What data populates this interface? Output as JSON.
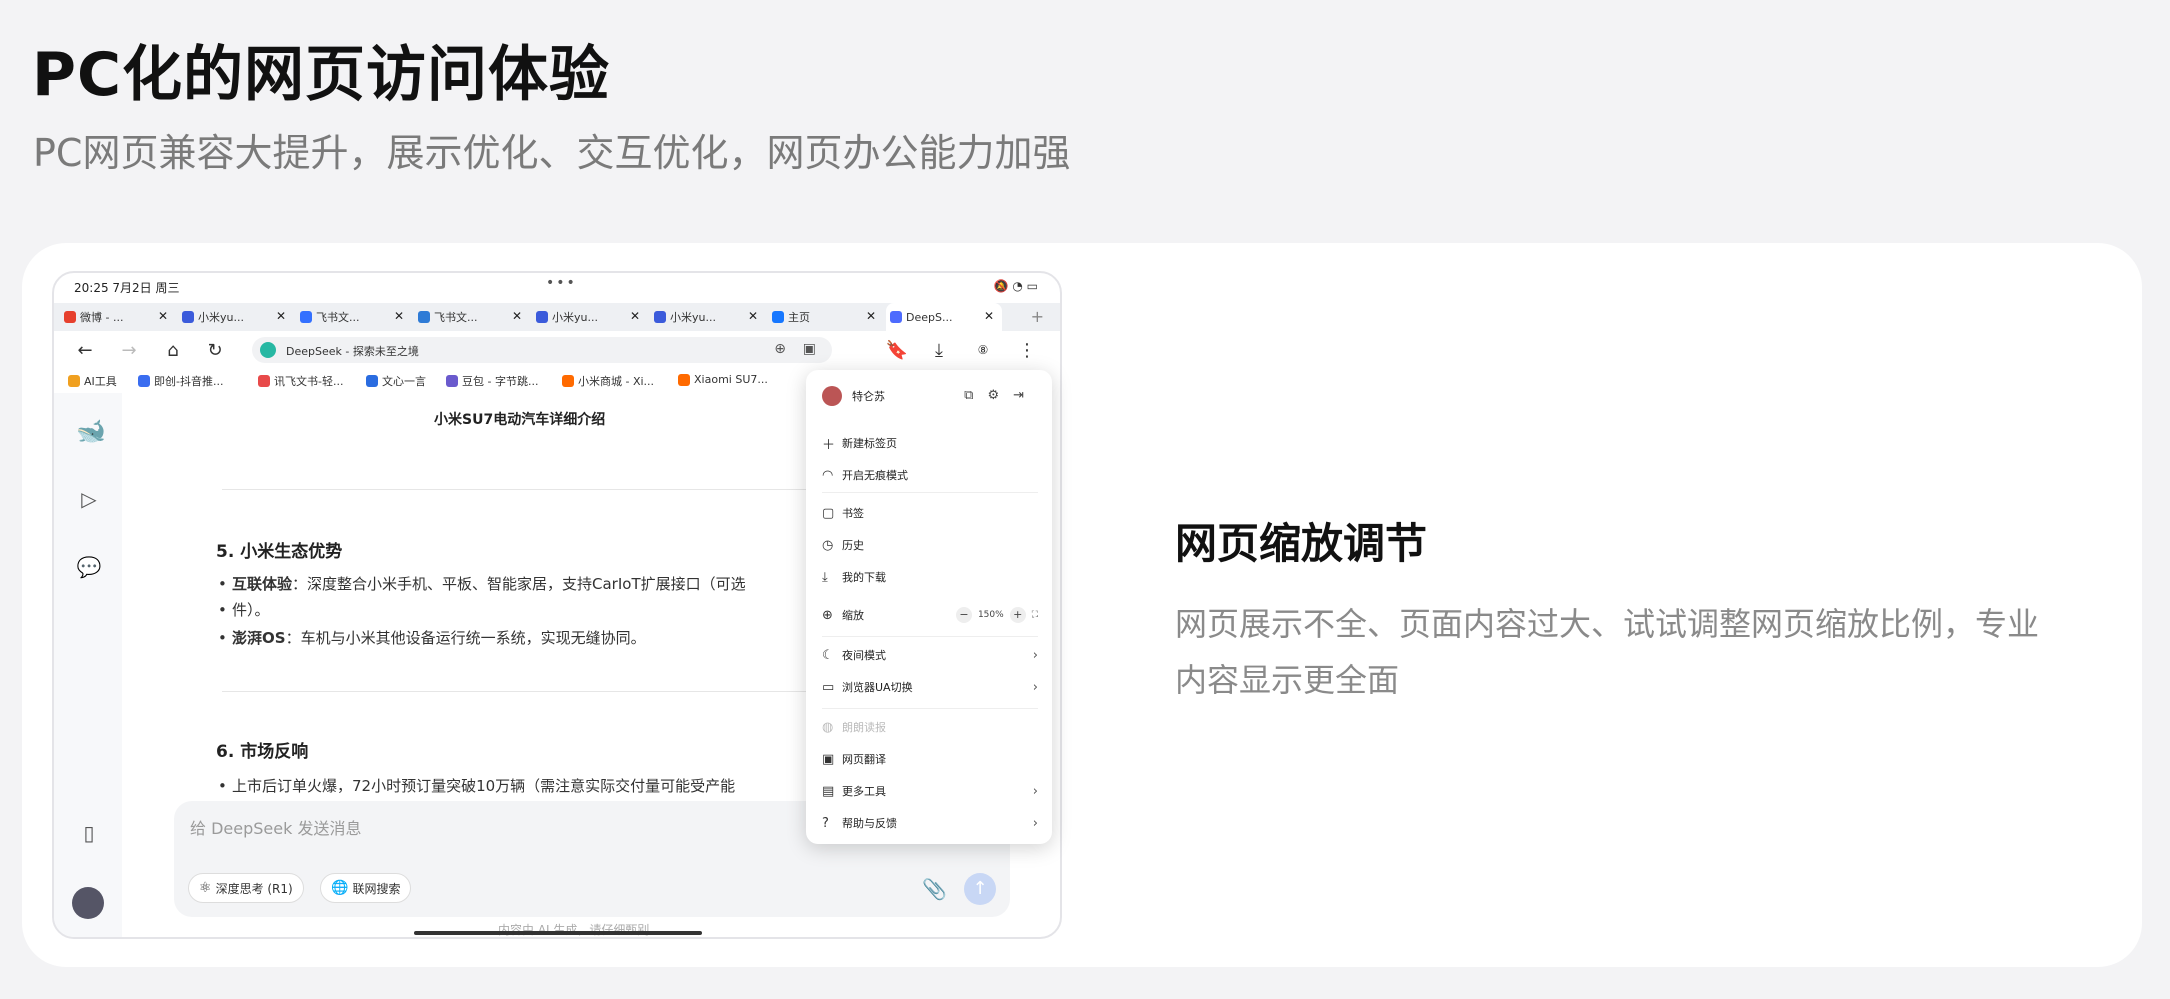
{
  "header": {
    "title": "PC化的网页访问体验",
    "subtitle": "PC网页兼容大提升，展示优化、交互优化，网页办公能力加强"
  },
  "feature": {
    "title": "网页缩放调节",
    "description": "网页展示不全、页面内容过大、试试调整网页缩放比例，专业内容显示更全面"
  },
  "status_bar": {
    "time": "20:25  7月2日 周三",
    "dots": "•••"
  },
  "tabs": [
    {
      "label": "微博 - ...",
      "color": "#e6402d"
    },
    {
      "label": "小米yu...",
      "color": "#3b5bdb"
    },
    {
      "label": "飞书文...",
      "color": "#3370ff"
    },
    {
      "label": "飞书文...",
      "color": "#2e7bd6"
    },
    {
      "label": "小米yu...",
      "color": "#3b5bdb"
    },
    {
      "label": "小米yu...",
      "color": "#3b5bdb"
    },
    {
      "label": "主页",
      "color": "#1677ff"
    },
    {
      "label": "DeepS...",
      "color": "#4d6bfe"
    }
  ],
  "toolbar": {
    "url": "DeepSeek - 探索未至之境"
  },
  "bookmarks": [
    {
      "label": "AI工具",
      "color": "#f0a020"
    },
    {
      "label": "即创-抖音推...",
      "color": "#3a6df0"
    },
    {
      "label": "讯飞文书-轻...",
      "color": "#e84a4a"
    },
    {
      "label": "文心一言",
      "color": "#2a6ce0"
    },
    {
      "label": "豆包 - 字节跳...",
      "color": "#6a5acd"
    },
    {
      "label": "小米商城 - Xi...",
      "color": "#ff6a00"
    },
    {
      "label": "Xiaomi SU7...",
      "color": "#ff6a00"
    }
  ],
  "document": {
    "title": "小米SU7电动汽车详细介绍",
    "section5_title": "5. 小米生态优势",
    "item1_bold": "互联体验",
    "item1_text": "：深度整合小米手机、平板、智能家居，支持CarIoT扩展接口（可选",
    "item1_cont": "件）。",
    "item2_bold": "澎湃OS",
    "item2_text": "：车机与小米其他设备运行统一系统，实现无缝协同。",
    "section6_title": "6. 市场反响",
    "item3_text": "上市后订单火爆，72小时预订量突破10万辆（需注意实际交付量可能受产能"
  },
  "chat_input": {
    "placeholder": "给 DeepSeek 发送消息",
    "chip1": "深度思考 (R1)",
    "chip2": "联网搜索",
    "footnote": "内容由 AI 生成，请仔细甄别"
  },
  "menu": {
    "user_name": "特仑苏",
    "items": {
      "new_tab": "新建标签页",
      "incognito": "开启无痕模式",
      "bookmarks": "书签",
      "history": "历史",
      "downloads": "我的下载",
      "zoom": "缩放",
      "zoom_value": "150%",
      "night_mode": "夜间模式",
      "ua_switch": "浏览器UA切换",
      "voice": "朗朗读报",
      "translate": "网页翻译",
      "more_tools": "更多工具",
      "help": "帮助与反馈"
    }
  }
}
